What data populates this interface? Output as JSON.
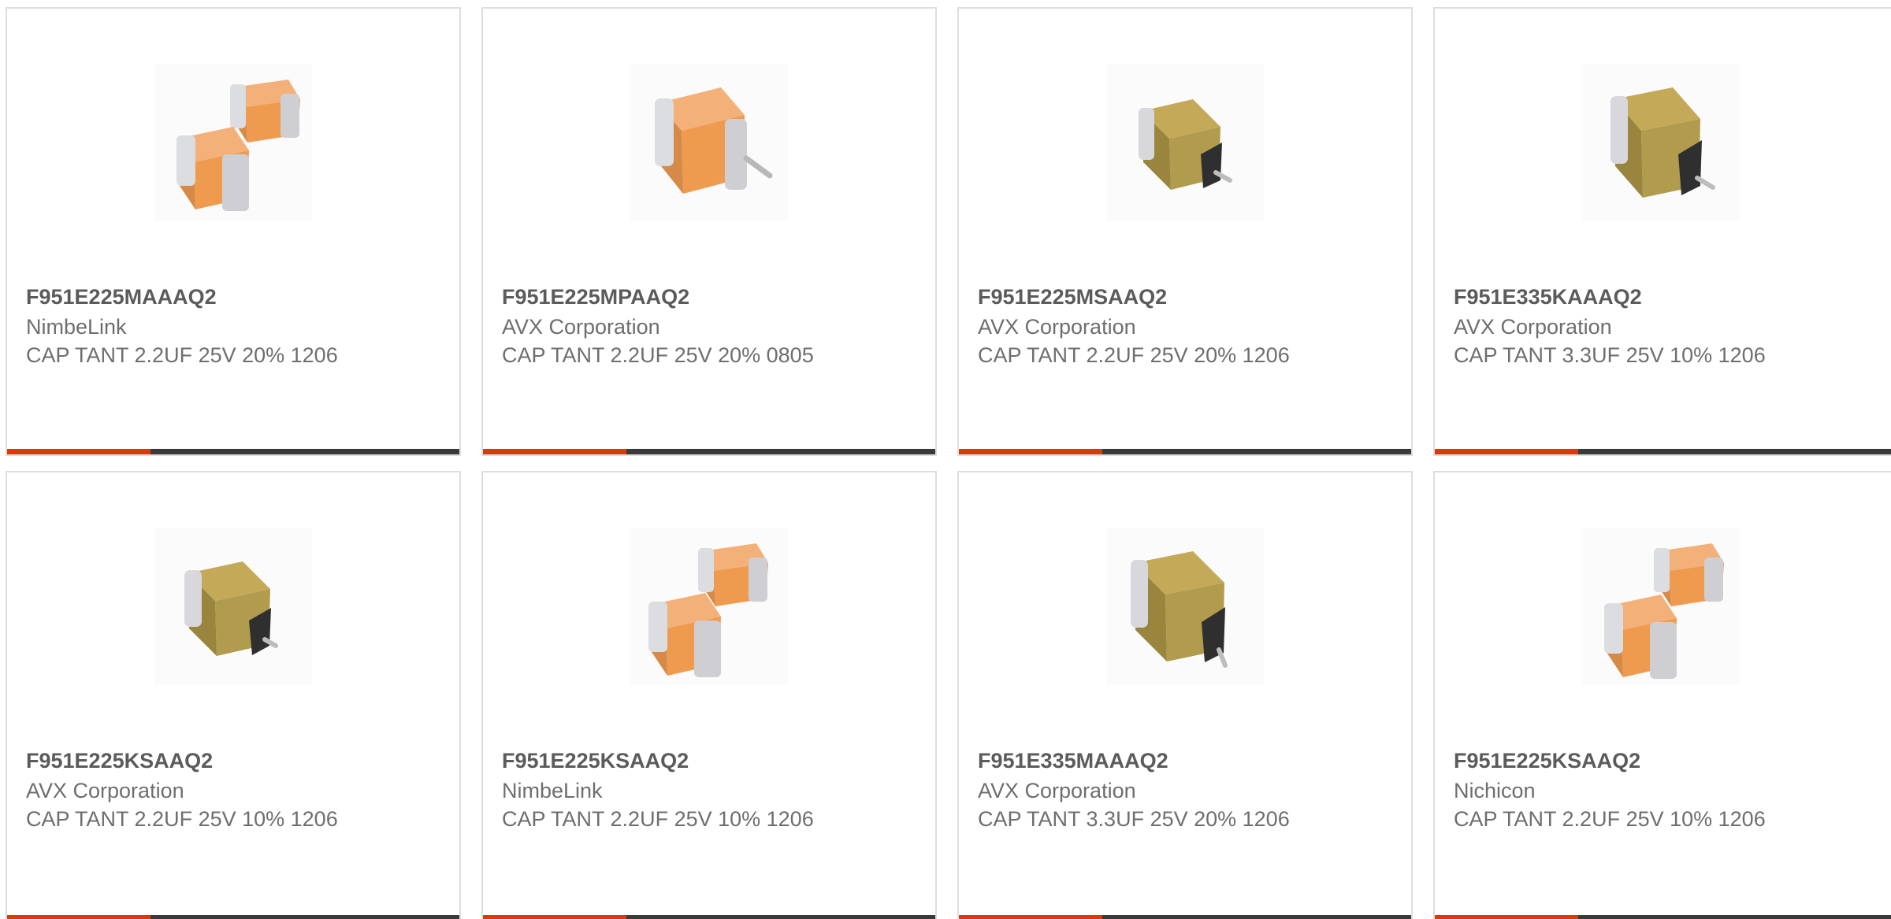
{
  "colors": {
    "accent": "#d83a0f",
    "bar": "#3a3a3a",
    "title_text": "#5b5b5b",
    "body_text": "#6e6e6e",
    "border": "#dedede"
  },
  "products": [
    {
      "part_number": "F951E225MAAAQ2",
      "manufacturer": "NimbeLink",
      "description": "CAP TANT 2.2UF 25V 20% 1206",
      "image_icon": "capacitor-pair-orange-icon"
    },
    {
      "part_number": "F951E225MPAAQ2",
      "manufacturer": "AVX Corporation",
      "description": "CAP TANT 2.2UF 25V 20% 0805",
      "image_icon": "capacitor-orange-lead-icon"
    },
    {
      "part_number": "F951E225MSAAQ2",
      "manufacturer": "AVX Corporation",
      "description": "CAP TANT 2.2UF 25V 20% 1206",
      "image_icon": "capacitor-olive-icon"
    },
    {
      "part_number": "F951E335KAAAQ2",
      "manufacturer": "AVX Corporation",
      "description": "CAP TANT 3.3UF 25V 10% 1206",
      "image_icon": "capacitor-olive-icon"
    },
    {
      "part_number": "F951E225KSAAQ2",
      "manufacturer": "AVX Corporation",
      "description": "CAP TANT 2.2UF 25V 10% 1206",
      "image_icon": "capacitor-olive-icon"
    },
    {
      "part_number": "F951E225KSAAQ2",
      "manufacturer": "NimbeLink",
      "description": "CAP TANT 2.2UF 25V 10% 1206",
      "image_icon": "capacitor-pair-orange-icon"
    },
    {
      "part_number": "F951E335MAAAQ2",
      "manufacturer": "AVX Corporation",
      "description": "CAP TANT 3.3UF 25V 20% 1206",
      "image_icon": "capacitor-olive-icon"
    },
    {
      "part_number": "F951E225KSAAQ2",
      "manufacturer": "Nichicon",
      "description": "CAP TANT 2.2UF 25V 10% 1206",
      "image_icon": "capacitor-pair-orange-icon"
    }
  ]
}
